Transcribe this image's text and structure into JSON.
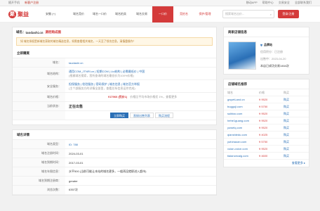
{
  "topbar": {
    "left": [
      "随开手机",
      "新客户注册"
    ],
    "right": [
      "移动APP",
      "帮助中心",
      "交易安全",
      "全部联系我们"
    ]
  },
  "header": {
    "logo_text": "聚益",
    "logo_mark": "聚",
    "location": "安徽 (+)",
    "nav": [
      "域名竞价",
      "域名一口价",
      "域名拍卖",
      "域名交易",
      "一口价",
      "竞拍名",
      "保护/管理"
    ],
    "active_nav": "一口价",
    "search_placeholder": "搜索域名出价...",
    "login": "登录/注册"
  },
  "detail": {
    "domain_label": "域名：",
    "domain": "taodashi.cn",
    "status": "源而购成图",
    "notice": "如 域名授权是新域名获取的域名精选信息，如需查看相关域名，一天至了领先信息，清慎重操作！",
    "buy_title": "立即購買",
    "rows": [
      {
        "k": "域名：",
        "v1": "taodashi.cn",
        "v2": "查看 · Whois · 网址"
      },
      {
        "k": "域名结构：",
        "v1": "通用COM_JTNRI.cn  |  短期COM  |  Ltd结构  |  必需最低价  |  中国",
        "v2": "(根據域名搜索，您所查询的域名最低价为100%价格)"
      },
      {
        "k": "安全服务：",
        "v1": "担保服务  |  检验服务  |  密码保护  |  域名信息  |  域名官方举报",
        "v2": "(主个部服务方的详情全部里，查看总系信息运作完成)"
      },
      {
        "k": "域名价格：",
        "v1": "¥17960 (优价1)",
        "v2": "价格比平均市场价格优 1%，查看更多"
      },
      {
        "k": "当前状态：",
        "v1": "正在出售",
        "v2": ""
      }
    ],
    "buttons": [
      "立即购买",
      "直接出售列表",
      "购买流程"
    ],
    "info_title": "域名详情",
    "info_rows": [
      {
        "k": "域名类型：",
        "v": "ID: 788"
      },
      {
        "k": "域名注册时间：",
        "v": "2024-03-01"
      },
      {
        "k": "域名到期时间：",
        "v": "2017-03-01"
      },
      {
        "k": "域名年限信息：",
        "v": "水平500 (当前可能让本站的域名更多，一般再没就职进入超市)"
      },
      {
        "k": "域名到期注册商：",
        "v": "greater"
      },
      {
        "k": "浏览次数：",
        "v": "6357次"
      }
    ]
  },
  "shop": {
    "title": "商家店铺信息",
    "name": "品牌站",
    "line1": "信用积分：已注册",
    "line2": "出售中：2023-04-20",
    "line3": "本店已成功交易1464次"
  },
  "shop_domains": {
    "title": "店铺域名推荐",
    "headers": [
      "域名",
      "价格",
      "购买"
    ],
    "items": [
      {
        "d": "gwyetLand.cn",
        "p": "¥ 9520",
        "b": "购买"
      },
      {
        "d": "bugguji.com",
        "p": "¥ 5750",
        "b": "购买"
      },
      {
        "d": "suibiao.com",
        "p": "¥ 9520",
        "b": "购买"
      },
      {
        "d": "hehe1guang.com",
        "p": "¥ 9520",
        "b": "购买"
      },
      {
        "d": "yowelq.com",
        "p": "¥ 9520",
        "b": "购买"
      },
      {
        "d": "qianshiedu.com",
        "p": "¥ 4025",
        "b": "购买"
      },
      {
        "d": "yufuhaoan.com",
        "p": "¥ 5750",
        "b": "购买"
      },
      {
        "d": "voian-voice.com",
        "p": "¥ 9520",
        "b": "购买"
      },
      {
        "d": "tiaiancecaig.com",
        "p": "¥ 4600",
        "b": "购买"
      }
    ],
    "more": "查看更多 ▸"
  }
}
